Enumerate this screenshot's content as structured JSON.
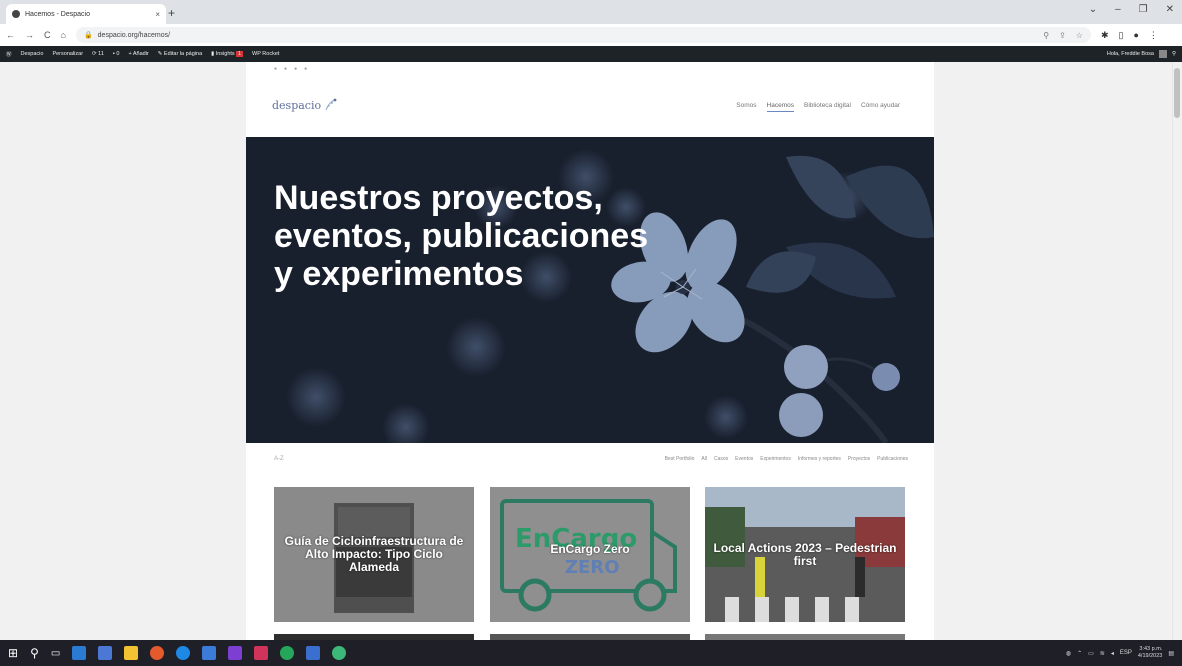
{
  "browser": {
    "tab_title": "Hacemos - Despacio",
    "tab_close": "×",
    "new_tab": "+",
    "url": "despacio.org/hacemos/",
    "nav": {
      "back": "←",
      "forward": "→",
      "reload": "C",
      "home": "⌂"
    },
    "window_controls": {
      "expand": "⌄",
      "minimize": "–",
      "maximize": "❐",
      "close": "✕"
    }
  },
  "wp_admin_bar": {
    "site_name": "Despacio",
    "customize": "Personalizar",
    "updates": "11",
    "comments": "0",
    "new": "Añadir",
    "edit": "Editar la página",
    "insights": "Insights",
    "insights_badge": "1",
    "rocket": "WP Rocket",
    "greeting": "Hola, Freddie Bosa"
  },
  "site": {
    "logo_text": "despacio",
    "menu": [
      "Somos",
      "Hacemos",
      "Biblioteca digital",
      "Cómo ayudar"
    ],
    "active_menu": "Hacemos",
    "hero_title": "Nuestros proyectos, eventos, publicaciones y experimentos",
    "az_label": "A-Z",
    "filters": [
      "Best Portfolio",
      "All",
      "Casos",
      "Eventos",
      "Experimentos",
      "Informes y reportes",
      "Proyectos",
      "Publicaciones"
    ]
  },
  "cards": [
    {
      "title": "Guía de Cicloinfraestructura de Alto Impacto: Tipo Ciclo Alameda",
      "image_caption": "Guía de Cicloinfraestructura"
    },
    {
      "title": "EnCargo Zero",
      "logo_text_top": "EnCargo",
      "logo_text_bottom": "ZERO"
    },
    {
      "title": "Local Actions 2023 – Pedestrian first"
    }
  ],
  "taskbar": {
    "time": "3:43 p.m.",
    "date": "4/19/2023",
    "lang": "ESP"
  },
  "colors": {
    "wp_bar": "#1d2327",
    "hero_bg": "#1c2431",
    "brand_blue": "#5d6f9d",
    "taskbar": "#1f1f28",
    "card_gray": "#8a8a8a"
  }
}
